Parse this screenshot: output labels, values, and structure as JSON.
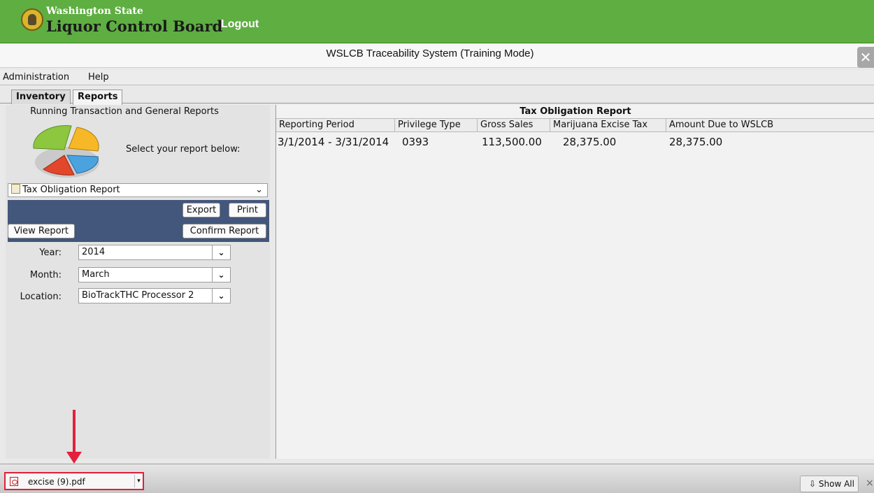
{
  "header": {
    "org_line1": "Washington State",
    "org_line2": "Liquor Control Board",
    "logout_label": "Logout"
  },
  "window": {
    "title": "WSLCB Traceability System (Training Mode)",
    "close_icon": "close-icon"
  },
  "menu": {
    "items": [
      "Administration",
      "Help"
    ]
  },
  "tabs": [
    {
      "label": "Inventory",
      "active": false
    },
    {
      "label": "Reports",
      "active": true
    }
  ],
  "left_panel": {
    "heading": "Running Transaction and General Reports",
    "select_prompt": "Select your report below:",
    "report_selected": "Tax Obligation Report",
    "export_label": "Export",
    "print_label": "Print",
    "view_report_label": "View Report",
    "confirm_report_label": "Confirm Report",
    "year_label": "Year:",
    "year_value": "2014",
    "month_label": "Month:",
    "month_value": "March",
    "location_label": "Location:",
    "location_value": "BioTrackTHC Processor 2",
    "panel_color": "#43567b"
  },
  "report": {
    "title": "Tax Obligation Report",
    "columns": [
      "Reporting Period",
      "Privilege Type",
      "Gross Sales",
      "Marijuana Excise Tax",
      "Amount Due to WSLCB"
    ],
    "rows": [
      [
        "3/1/2014 - 3/31/2014",
        "0393",
        "113,500.00",
        "28,375.00",
        "28,375.00"
      ]
    ]
  },
  "downloads": {
    "file_name": "excise (9).pdf",
    "show_all_label": "Show All",
    "close_glyph": "×",
    "highlight_color": "#e0203a"
  },
  "colors": {
    "header_green": "#5eae42",
    "annotation_red": "#e4203b"
  }
}
